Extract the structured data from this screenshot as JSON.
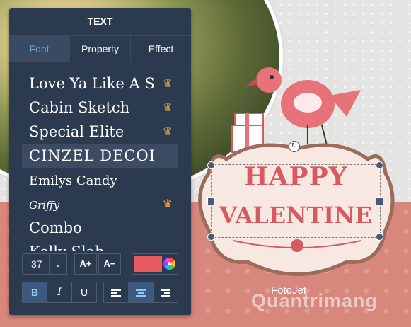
{
  "panel": {
    "title": "TEXT",
    "tabs": [
      {
        "label": "Font",
        "active": true
      },
      {
        "label": "Property",
        "active": false
      },
      {
        "label": "Effect",
        "active": false
      }
    ],
    "fonts": [
      {
        "label": "Love Ya Like A S",
        "premium": true,
        "selected": false
      },
      {
        "label": "Cabin Sketch",
        "premium": true,
        "selected": false
      },
      {
        "label": "Special Elite",
        "premium": true,
        "selected": false
      },
      {
        "label": "CINZEL DECOI",
        "premium": false,
        "selected": true
      },
      {
        "label": "Emilys Candy",
        "premium": false,
        "selected": false
      },
      {
        "label": "Griffy",
        "premium": true,
        "selected": false
      },
      {
        "label": "Combo",
        "premium": false,
        "selected": false
      },
      {
        "label": "Kelly Slab",
        "premium": false,
        "selected": false
      }
    ],
    "crown_icon": "♛",
    "font_size": "37",
    "font_size_chevron": "⌄",
    "size_up_label": "A+",
    "size_down_label": "A−",
    "text_color": "#e65a5e",
    "bold_label": "B",
    "italic_label": "I",
    "underline_label": "U",
    "bold_active": true,
    "align_active": "center"
  },
  "canvas": {
    "line1": "HAPPY",
    "line2": "VALENTINE",
    "brand": "FotoJet",
    "watermark": "Quantrimang",
    "accent_color": "#d65a60",
    "background_color": "#d8877c"
  }
}
